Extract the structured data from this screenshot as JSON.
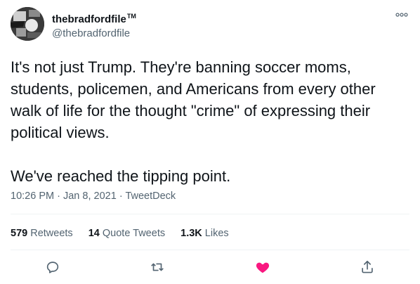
{
  "user": {
    "display_name": "thebradfordfile",
    "trademark": "TM",
    "handle": "@thebradfordfile"
  },
  "tweet": {
    "text": "It's not just Trump. They're banning soccer moms,\nstudents, policemen, and Americans from every other\nwalk of life for the thought \"crime\" of expressing their\npolitical views.\n\nWe've reached the tipping point.",
    "time": "10:26 PM",
    "date": "Jan 8, 2021",
    "source": "TweetDeck",
    "sep": "·"
  },
  "stats": {
    "retweets_count": "579",
    "retweets_label": "Retweets",
    "quotes_count": "14",
    "quotes_label": "Quote Tweets",
    "likes_count": "1.3K",
    "likes_label": "Likes"
  },
  "colors": {
    "like": "#f91880",
    "secondary": "#536471",
    "accent": "#1d9bf0"
  },
  "icons": [
    "reply-icon",
    "retweet-icon",
    "like-icon",
    "share-icon",
    "more-icon"
  ]
}
